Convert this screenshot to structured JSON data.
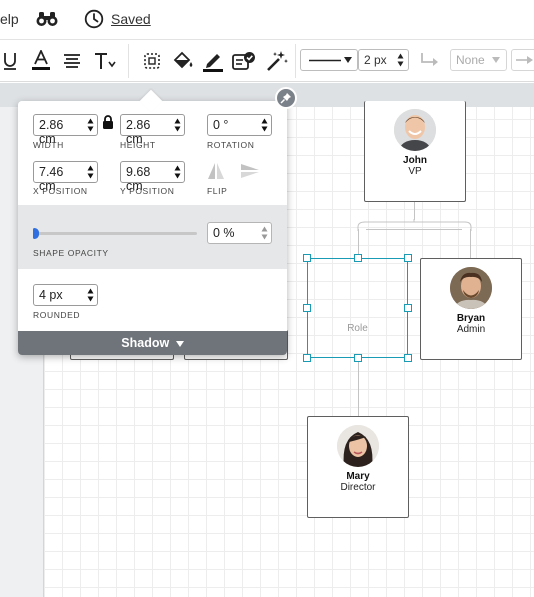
{
  "menubar": {
    "help_label": "elp",
    "saved_label": "Saved"
  },
  "toolbar": {
    "line_width": "2 px",
    "arrow_style": "None"
  },
  "panel": {
    "width": {
      "value": "2.86 cm",
      "label": "WIDTH"
    },
    "height": {
      "value": "2.86 cm",
      "label": "HEIGHT"
    },
    "rotation": {
      "value": "0 °",
      "label": "ROTATION"
    },
    "x_position": {
      "value": "7.46 cm",
      "label": "X POSITION"
    },
    "y_position": {
      "value": "9.68 cm",
      "label": "Y POSITION"
    },
    "flip_label": "FLIP",
    "opacity": {
      "value": "0 %",
      "label": "SHAPE OPACITY",
      "fraction": 0.0
    },
    "rounded": {
      "value": "4 px",
      "label": "ROUNDED"
    },
    "shadow_label": "Shadow"
  },
  "org": {
    "john": {
      "name": "John",
      "role": "VP"
    },
    "bryan": {
      "name": "Bryan",
      "role": "Admin"
    },
    "mary": {
      "name": "Mary",
      "role": "Director"
    },
    "placeholder": {
      "role": "Role"
    }
  },
  "colors": {
    "accent": "#1a9bb5",
    "slider": "#2f6fdf",
    "panel_bar": "#6e747a"
  }
}
